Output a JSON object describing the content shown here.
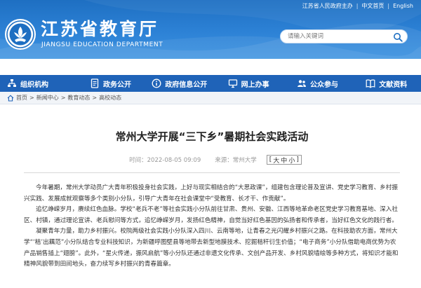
{
  "topbar": {
    "host": "江苏省人民政府主办",
    "chinese": "中文首页",
    "english": "English"
  },
  "logo": {
    "cn": "江苏省教育厅",
    "en": "JIANGSU EDUCATION DEPARTMENT"
  },
  "search": {
    "placeholder": "请输入关键词"
  },
  "nav": {
    "items": [
      {
        "label": "组织机构",
        "icon": "org-chart-icon"
      },
      {
        "label": "政务公开",
        "icon": "document-icon"
      },
      {
        "label": "政府信息公开",
        "icon": "info-icon"
      },
      {
        "label": "网上办事",
        "icon": "computer-icon"
      },
      {
        "label": "公众参与",
        "icon": "people-icon"
      },
      {
        "label": "文献资料",
        "icon": "book-icon"
      }
    ]
  },
  "breadcrumb": [
    "首页",
    ">",
    "新闻中心",
    ">",
    "教育动态",
    ">",
    "高校动态"
  ],
  "article": {
    "title": "常州大学开展“三下乡”暑期社会实践活动",
    "time": "时间：2022-08-05 09:09",
    "source": "来源：常州大学",
    "fontsize_open": "[",
    "fontsize_large": "大",
    "fontsize_medium": "中",
    "fontsize_small": "小",
    "fontsize_close": "]",
    "paragraphs": [
      "今年暑期，常州大学动员广大青年积极投身社会实践，上好与现实相结合的“大思政课”，组建包含理论普及宣讲、党史学习教育、乡村振兴实践、发展成就观察等多个类别小分队，引导广大青年在社会课堂中“受教育、长才干、作贡献”。",
      "追忆峥嵘岁月，赓续红色血脉。学校“老兵不老”等社会实践小分队前往甘肃、贵州、安徽、江西等地革命老区党史学习教育基地、深入社区、村镇，通过理论宣讲、老兵慰问等方式，追忆峥嵘岁月，发扬红色精神，自觉当好红色基因的弘扬者和传承者，当好红色文化的践行者。",
      "凝聚青年力量，助力乡村振兴。校院两级社会实践小分队深入四川、云南等地，让青春之光闪耀乡村振兴之路。在科技助农方面，常州大学“‘秸’出藕范”小分队结合专业科技知识，为新疆呼图壁县等地带去新型地膜技术、挖掘秸秆衍生价值；“电子商务”小分队借助电商优势为农产品销售插上“翅膀”。此外，“星火传递，振风启航”等小分队还通过非遗文化传承、文创产品开发、乡村风貌墙绘等多种方式，将知识才能和精神风貌带到田间地头，奋力续写乡村振兴的青春篇章。"
    ]
  },
  "colors": {
    "header": "#2d82d6",
    "nav": "#1f63b8",
    "breadcrumb_bg": "#f1f4f8"
  }
}
